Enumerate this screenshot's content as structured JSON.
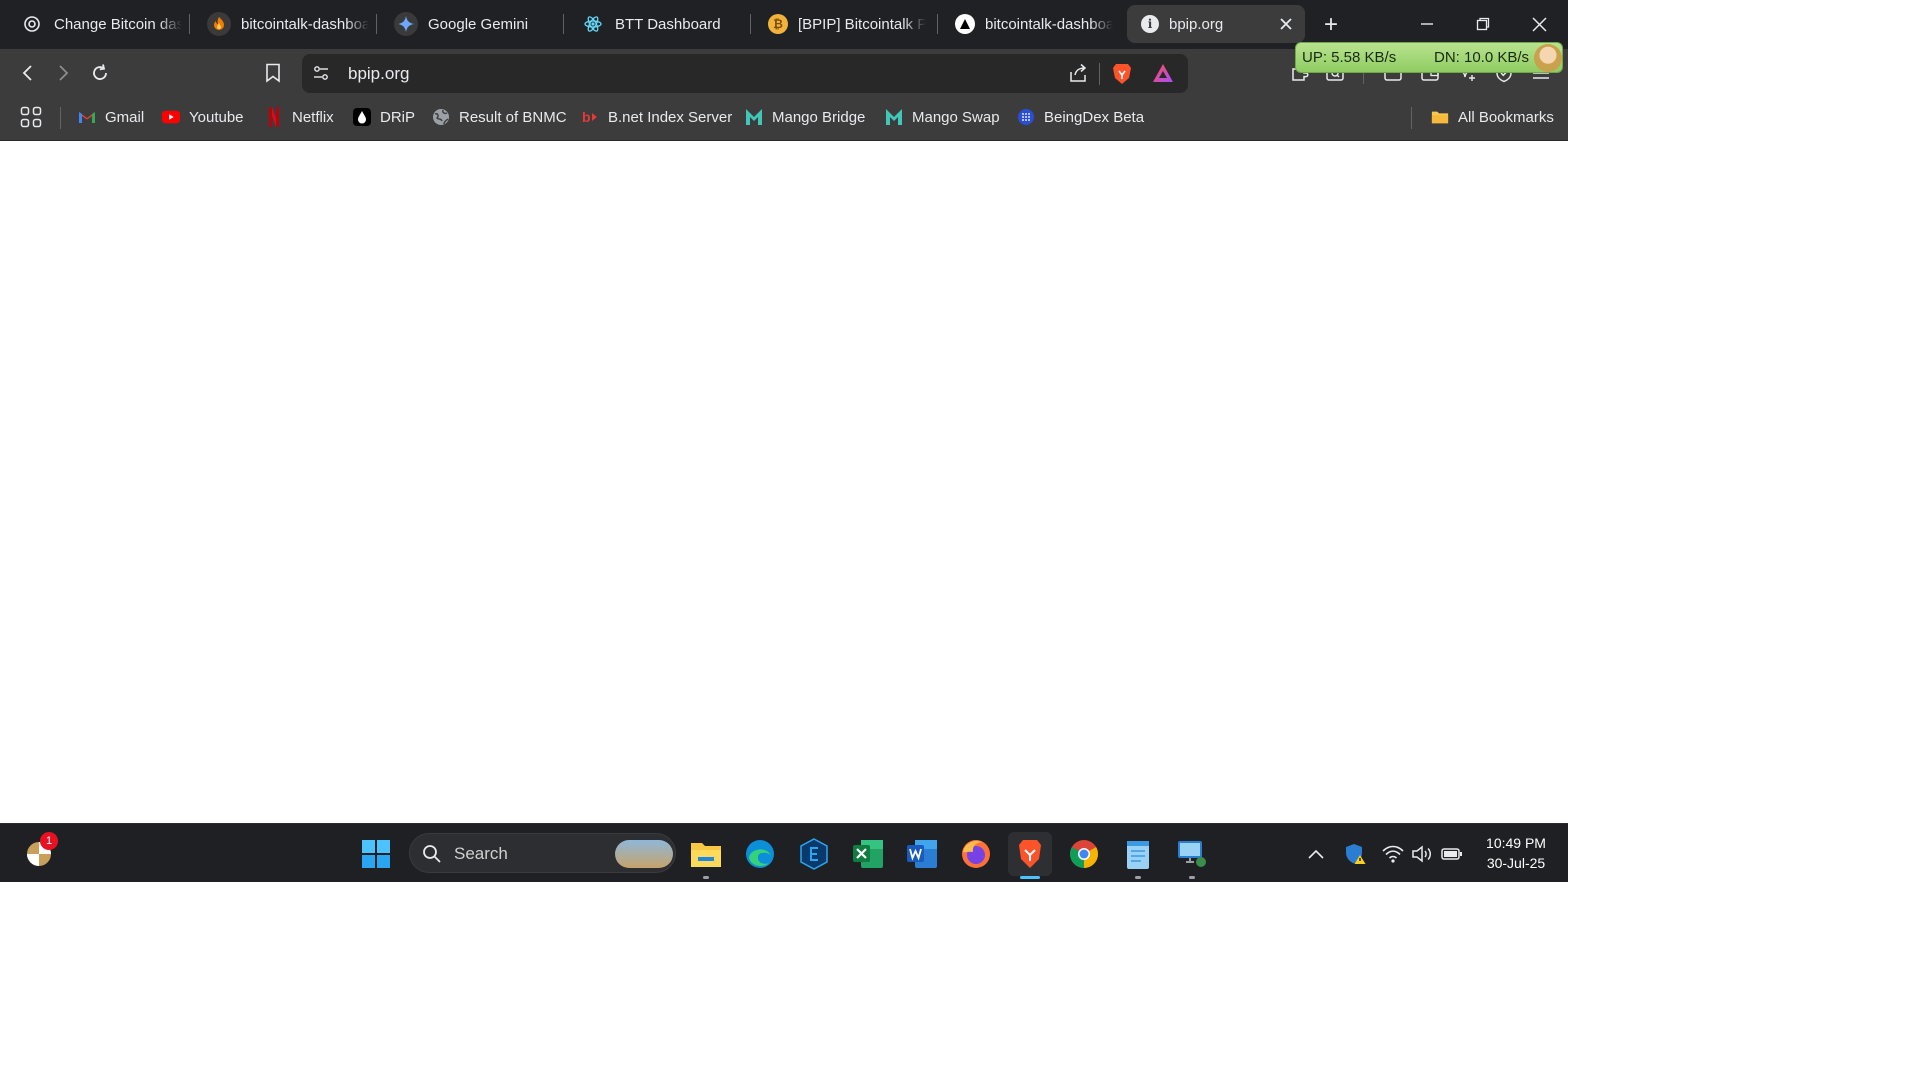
{
  "browser": {
    "tabs": [
      {
        "title": "Change Bitcoin dashboard",
        "icon": "openai-icon",
        "active": false
      },
      {
        "title": "bitcointalk-dashboard",
        "icon": "firefox-like-icon",
        "active": false
      },
      {
        "title": "Google Gemini",
        "icon": "gemini-icon",
        "active": false
      },
      {
        "title": "BTT Dashboard",
        "icon": "react-icon",
        "active": false
      },
      {
        "title": "[BPIP] Bitcointalk Pu",
        "icon": "bitcoin-icon",
        "active": false
      },
      {
        "title": "bitcointalk-dashboa",
        "icon": "vercel-icon",
        "active": false
      },
      {
        "title": "bpip.org",
        "icon": "info-icon",
        "active": true
      }
    ],
    "new_tab_label": "+",
    "address": {
      "url": "bpip.org"
    },
    "bookmarks": [
      {
        "label": "Gmail",
        "icon": "gmail-icon"
      },
      {
        "label": "Youtube",
        "icon": "youtube-icon"
      },
      {
        "label": "Netflix",
        "icon": "netflix-icon"
      },
      {
        "label": "DRiP",
        "icon": "drip-icon"
      },
      {
        "label": "Result of BNMC",
        "icon": "globe-icon"
      },
      {
        "label": "B.net Index Server",
        "icon": "bnet-icon"
      },
      {
        "label": "Mango Bridge",
        "icon": "mango-icon"
      },
      {
        "label": "Mango Swap",
        "icon": "mango-icon"
      },
      {
        "label": "BeingDex Beta",
        "icon": "beingdex-icon"
      }
    ],
    "all_bookmarks_label": "All Bookmarks"
  },
  "net_meter": {
    "up": "UP: 5.58 KB/s",
    "down": "DN: 10.0 KB/s"
  },
  "taskbar": {
    "search_placeholder": "Search",
    "weather_badge": "1",
    "clock": {
      "time": "10:49 PM",
      "date": "30-Jul-25"
    }
  },
  "colors": {
    "tabbar": "#202124",
    "toolbar": "#3c3c3c",
    "taskbar": "#1f2023",
    "netmeter": "#a8d97a"
  }
}
